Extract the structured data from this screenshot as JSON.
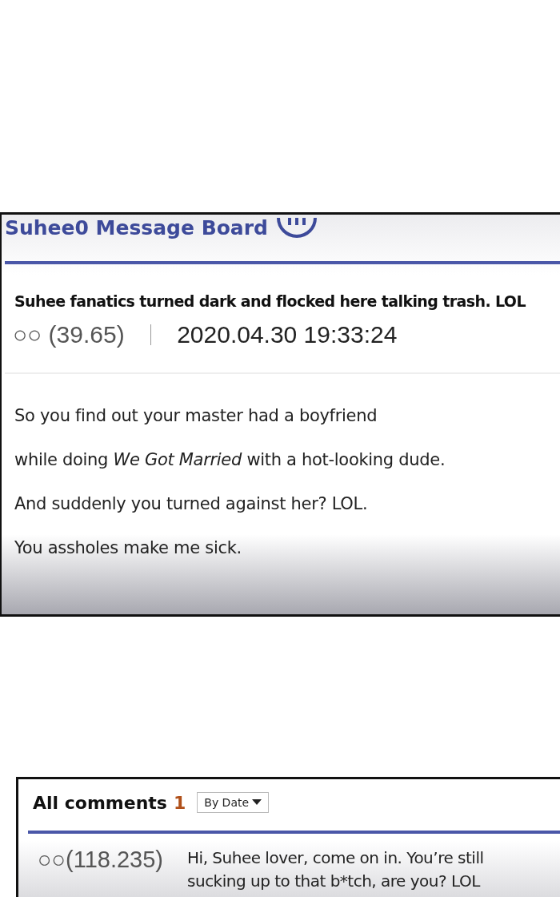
{
  "board": {
    "title": "Suhee0 Message Board",
    "post_title": "Suhee fanatics turned dark and flocked here talking trash. LOL",
    "author": "○○ (39.65)",
    "date": "2020.04.30 19:33:24",
    "body": [
      "So you find out your master had a boyfriend",
      "while doing *We Got Married* with a hot-looking dude.",
      "And suddenly you turned against her? LOL.",
      "You assholes make me sick."
    ]
  },
  "comments": {
    "heading": "All comments",
    "count": "1",
    "sort": "By Date",
    "items": [
      {
        "author": "○○(118.235)",
        "lines": [
          "Hi, Suhee lover, come on in. You’re still",
          "sucking up to that b*tch, are you? LOL"
        ]
      }
    ]
  }
}
